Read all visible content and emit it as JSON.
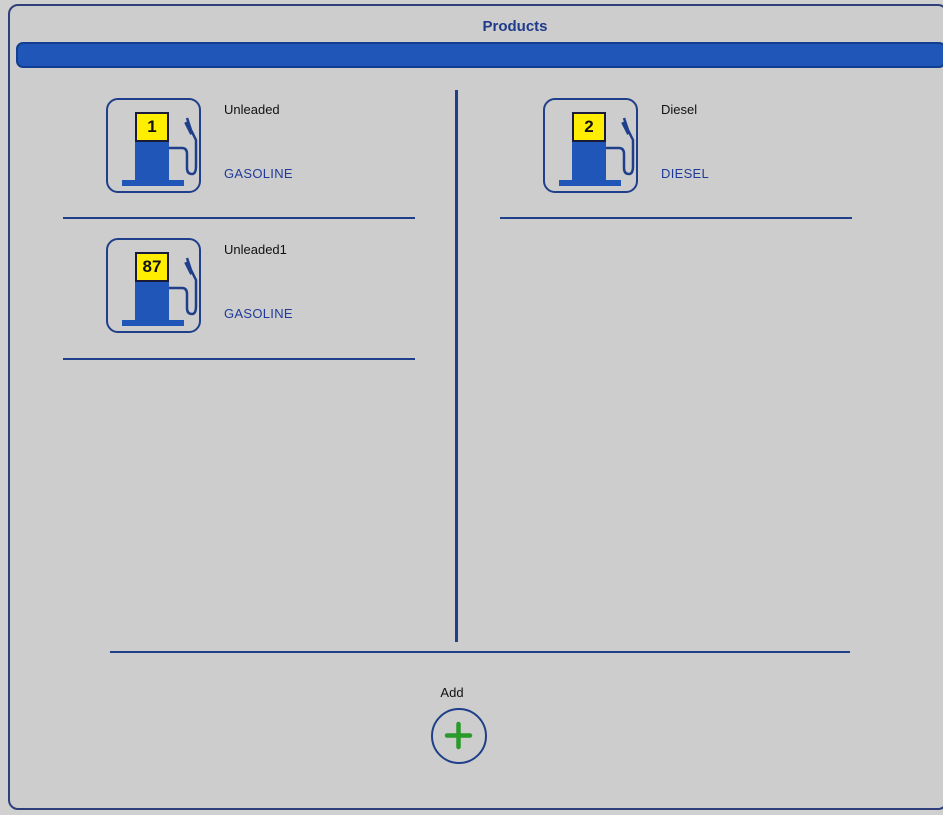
{
  "window": {
    "title": "Products"
  },
  "products": [
    {
      "number": "1",
      "name": "Unleaded",
      "type": "GASOLINE"
    },
    {
      "number": "87",
      "name": "Unleaded1",
      "type": "GASOLINE"
    },
    {
      "number": "2",
      "name": "Diesel",
      "type": "DIESEL"
    }
  ],
  "actions": {
    "add_label": "Add"
  },
  "colors": {
    "accent": "#1f56b8",
    "line": "#1f3f8a",
    "display_yellow": "#ffee00",
    "add_green": "#2a9a2a"
  },
  "icons": {
    "product": "fuel-pump-icon",
    "add": "plus-circle-icon"
  }
}
